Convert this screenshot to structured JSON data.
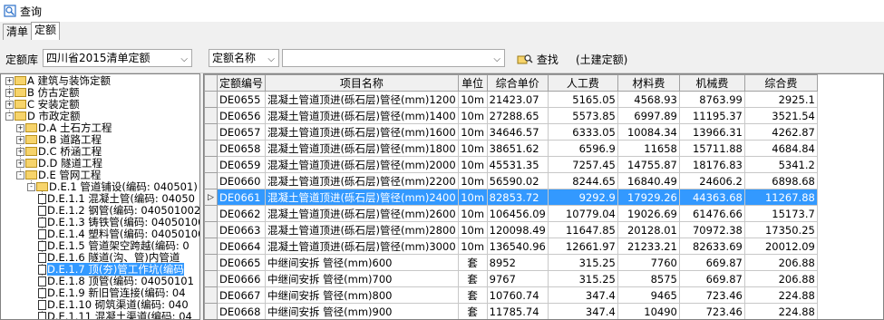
{
  "window": {
    "title": "查询"
  },
  "tabs": [
    {
      "label": "清单"
    },
    {
      "label": "定额"
    }
  ],
  "toolbar": {
    "library_label": "定额库",
    "library_value": "四川省2015清单定额",
    "field_select": "定额名称",
    "search_value": "",
    "search_button": "查找",
    "scope_label": "(土建定额)"
  },
  "tree": [
    {
      "text": "A 建筑与装饰定额",
      "type": "folder",
      "exp": "+"
    },
    {
      "text": "B 仿古定额",
      "type": "folder",
      "exp": "+"
    },
    {
      "text": "C 安装定额",
      "type": "folder",
      "exp": "+"
    },
    {
      "text": "D 市政定额",
      "type": "folder",
      "exp": "-"
    },
    {
      "text": "D.A 土石方工程",
      "type": "folder",
      "exp": "+"
    },
    {
      "text": "D.B 道路工程",
      "type": "folder",
      "exp": "+"
    },
    {
      "text": "D.C 桥涵工程",
      "type": "folder",
      "exp": "+"
    },
    {
      "text": "D.D 隧道工程",
      "type": "folder",
      "exp": "+"
    },
    {
      "text": "D.E 管网工程",
      "type": "folder",
      "exp": "-"
    },
    {
      "text": "D.E.1 管道铺设(编码: 040501)",
      "type": "folder",
      "exp": "-"
    },
    {
      "text": "D.E.1.1 混凝土管(编码: 04050",
      "type": "doc"
    },
    {
      "text": "D.E.1.2 钢管(编码: 040501002",
      "type": "doc"
    },
    {
      "text": "D.E.1.3 铸铁管(编码: 04050100",
      "type": "doc"
    },
    {
      "text": "D.E.1.4 塑料管(编码: 04050100",
      "type": "doc"
    },
    {
      "text": "D.E.1.5 管道架空跨越(编码: 0",
      "type": "doc"
    },
    {
      "text": "D.E.1.6 隧道(沟、管)内管道",
      "type": "doc"
    },
    {
      "text": "D.E.1.7 顶(夯)管工作坑(编码",
      "type": "doc",
      "selected": true
    },
    {
      "text": "D.E.1.8 顶管(编码: 04050101",
      "type": "doc"
    },
    {
      "text": "D.E.1.9 新旧管连接(编码: 04",
      "type": "doc"
    },
    {
      "text": "D.E.1.10 砌筑渠道(编码: 040",
      "type": "doc"
    },
    {
      "text": "D.E.1.11 混凝土渠道(编码: 04",
      "type": "doc"
    }
  ],
  "grid": {
    "columns": [
      "定额编号",
      "项目名称",
      "单位",
      "综合单价",
      "人工费",
      "材料费",
      "机械费",
      "综合费"
    ],
    "rows": [
      {
        "code": "DE0655",
        "name": "混凝土管道顶进(砾石层)管径(mm)1200",
        "unit": "10m",
        "price": "21423.07",
        "labor": "5165.05",
        "material": "4568.93",
        "machine": "8763.99",
        "overall": "2925.1"
      },
      {
        "code": "DE0656",
        "name": "混凝土管道顶进(砾石层)管径(mm)1400",
        "unit": "10m",
        "price": "27288.65",
        "labor": "5573.85",
        "material": "6997.89",
        "machine": "11195.37",
        "overall": "3521.54"
      },
      {
        "code": "DE0657",
        "name": "混凝土管道顶进(砾石层)管径(mm)1600",
        "unit": "10m",
        "price": "34646.57",
        "labor": "6333.05",
        "material": "10084.34",
        "machine": "13966.31",
        "overall": "4262.87"
      },
      {
        "code": "DE0658",
        "name": "混凝土管道顶进(砾石层)管径(mm)1800",
        "unit": "10m",
        "price": "38651.62",
        "labor": "6596.9",
        "material": "11658",
        "machine": "15711.88",
        "overall": "4684.84"
      },
      {
        "code": "DE0659",
        "name": "混凝土管道顶进(砾石层)管径(mm)2000",
        "unit": "10m",
        "price": "45531.35",
        "labor": "7257.45",
        "material": "14755.87",
        "machine": "18176.83",
        "overall": "5341.2"
      },
      {
        "code": "DE0660",
        "name": "混凝土管道顶进(砾石层)管径(mm)2200",
        "unit": "10m",
        "price": "56590.02",
        "labor": "8244.65",
        "material": "16840.49",
        "machine": "24606.2",
        "overall": "6898.68"
      },
      {
        "code": "DE0661",
        "name": "混凝土管道顶进(砾石层)管径(mm)2400",
        "unit": "10m",
        "price": "82853.72",
        "labor": "9292.9",
        "material": "17929.26",
        "machine": "44363.68",
        "overall": "11267.88",
        "selected": true
      },
      {
        "code": "DE0662",
        "name": "混凝土管道顶进(砾石层)管径(mm)2600",
        "unit": "10m",
        "price": "106456.09",
        "labor": "10779.04",
        "material": "19026.69",
        "machine": "61476.66",
        "overall": "15173.7"
      },
      {
        "code": "DE0663",
        "name": "混凝土管道顶进(砾石层)管径(mm)2800",
        "unit": "10m",
        "price": "120098.49",
        "labor": "11647.85",
        "material": "20128.01",
        "machine": "70972.38",
        "overall": "17350.25"
      },
      {
        "code": "DE0664",
        "name": "混凝土管道顶进(砾石层)管径(mm)3000",
        "unit": "10m",
        "price": "136540.96",
        "labor": "12661.97",
        "material": "21233.21",
        "machine": "82633.69",
        "overall": "20012.09"
      },
      {
        "code": "DE0665",
        "name": "中继间安拆 管径(mm)600",
        "unit": "套",
        "price": "8952",
        "labor": "315.25",
        "material": "7760",
        "machine": "669.87",
        "overall": "206.88"
      },
      {
        "code": "DE0666",
        "name": "中继间安拆 管径(mm)700",
        "unit": "套",
        "price": "9767",
        "labor": "315.25",
        "material": "8575",
        "machine": "669.87",
        "overall": "206.88"
      },
      {
        "code": "DE0667",
        "name": "中继间安拆 管径(mm)800",
        "unit": "套",
        "price": "10760.74",
        "labor": "347.4",
        "material": "9465",
        "machine": "723.46",
        "overall": "224.88"
      },
      {
        "code": "DE0668",
        "name": "中继间安拆 管径(mm)900",
        "unit": "套",
        "price": "11785.74",
        "labor": "347.4",
        "material": "10490",
        "machine": "723.46",
        "overall": "224.88"
      }
    ]
  },
  "colors": {
    "selection": "#3399ff",
    "header_bg": "#f0f0f0",
    "folder": "#f7d46b"
  }
}
